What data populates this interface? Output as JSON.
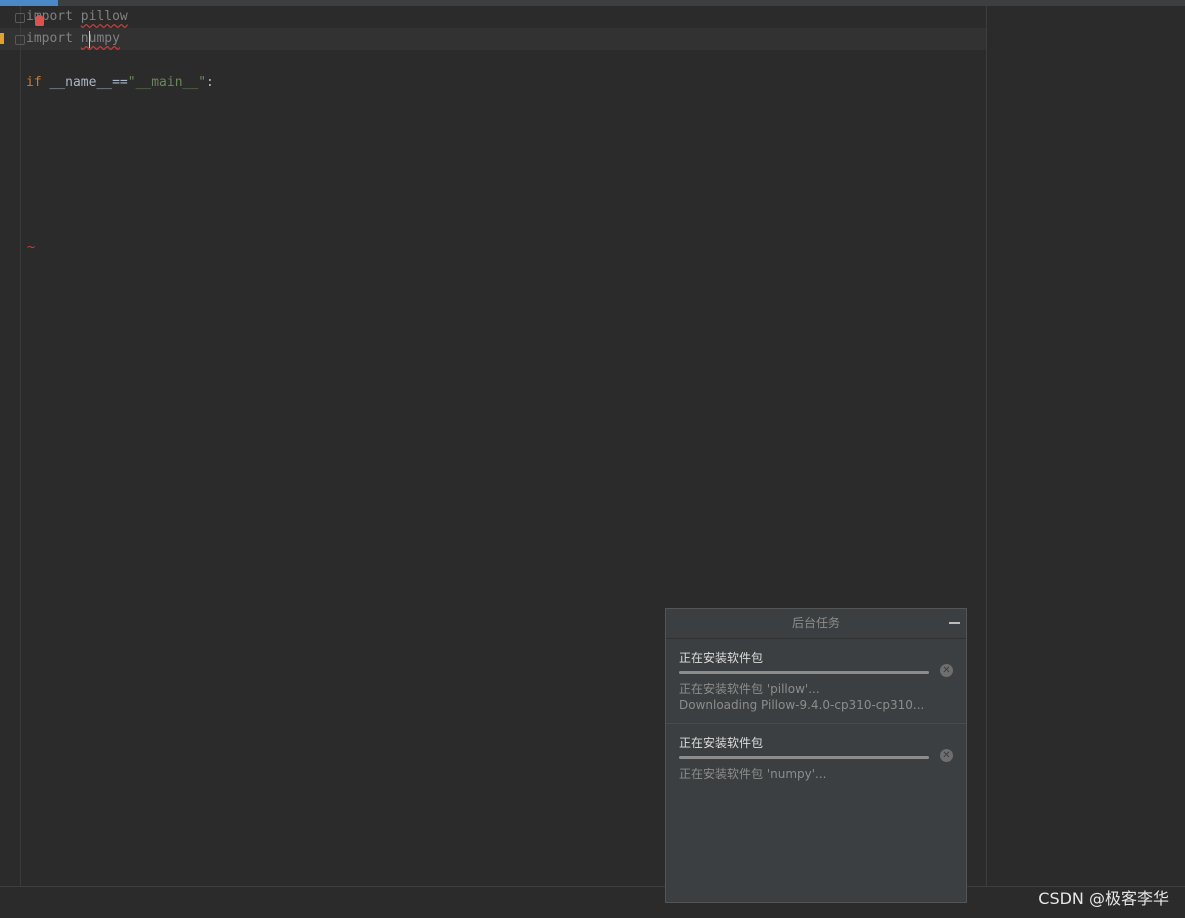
{
  "editor": {
    "lines": [
      {
        "keyword": "import",
        "module": "pillow"
      },
      {
        "keyword": "import",
        "module": "numpy"
      }
    ],
    "main_guard": {
      "kw": "if",
      "name": " __name__==",
      "str": "\"__main__\"",
      "colon": ":"
    },
    "squiggle_mark": "~"
  },
  "tasks_panel": {
    "title": "后台任务",
    "tasks": [
      {
        "title": "正在安装软件包",
        "progress": 1.0,
        "detail_1": "正在安装软件包 'pillow'...",
        "detail_2": "Downloading Pillow-9.4.0-cp310-cp310..."
      },
      {
        "title": "正在安装软件包",
        "progress": 1.0,
        "detail_1": "正在安装软件包 'numpy'..."
      }
    ]
  },
  "watermark": "CSDN @极客李华",
  "colors": {
    "background": "#2b2b2b",
    "keyword": "#cc7832",
    "string": "#6a8759",
    "panel": "#3c3f41",
    "error": "#bc3f3c",
    "warning": "#e0a230"
  },
  "icons": [
    "fold-icon",
    "bulb-icon",
    "minimize-icon",
    "cancel-icon"
  ]
}
